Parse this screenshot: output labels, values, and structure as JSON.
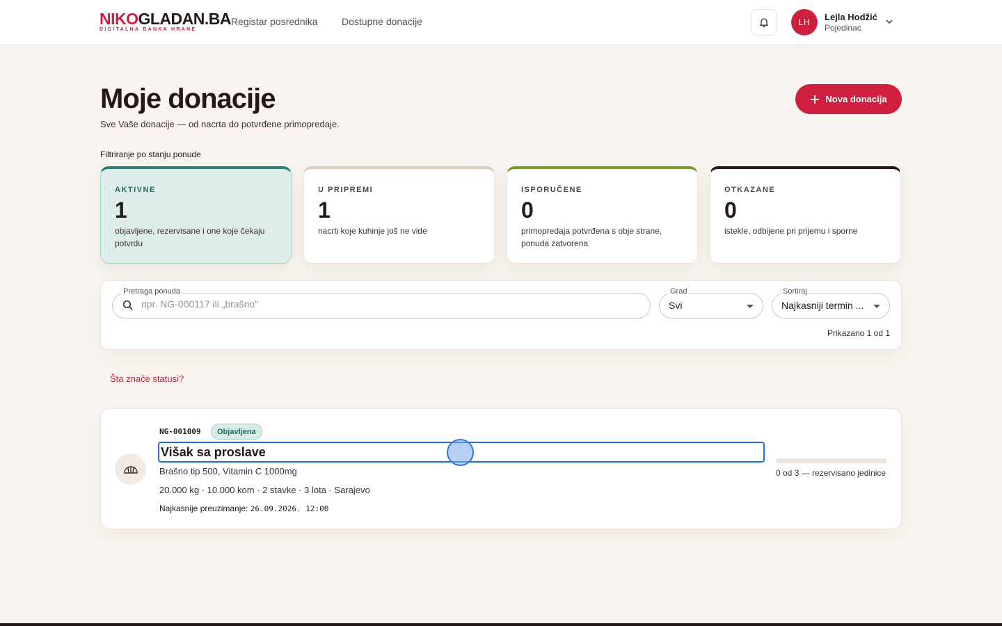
{
  "brand": {
    "logo_part1": "NIKO",
    "logo_part2": "GLADAN.BA",
    "tagline": "DIGITALNA BANKA HRANE"
  },
  "nav": {
    "link1": "Registar posrednika",
    "link2": "Dostupne donacije"
  },
  "user": {
    "initials": "LH",
    "name": "Lejla Hodžić",
    "role": "Pojedinac"
  },
  "page": {
    "title": "Moje donacije",
    "subtitle": "Sve Vaše donacije — od nacrta do potvrđene primopredaje.",
    "new_button": "Nova donacija"
  },
  "filters": {
    "heading": "Filtriranje po stanju ponude",
    "cards": [
      {
        "label": "AKTIVNE",
        "count": "1",
        "description": "objavljene, rezervisane i one koje čekaju potvrdu",
        "accent": "#2c7e74"
      },
      {
        "label": "U PRIPREMI",
        "count": "1",
        "description": "nacrti koje kuhinje još ne vide",
        "accent": "#d9cdbf"
      },
      {
        "label": "ISPORUČENE",
        "count": "0",
        "description": "primopredaja potvrđena s obje strane, ponuda zatvorena",
        "accent": "#7a9a2a"
      },
      {
        "label": "OTKAZANE",
        "count": "0",
        "description": "istekle, odbijene pri prijemu i sporne",
        "accent": "#231a17"
      }
    ]
  },
  "search": {
    "label": "Pretraga ponuda",
    "placeholder": "npr. NG-000117 ili „brašno\"",
    "city_label": "Grad",
    "city_value": "Svi",
    "sort_label": "Sortiraj",
    "sort_value": "Najkasniji termin ...",
    "result_count": "Prikazano 1 od 1"
  },
  "status_help": "Šta znače statusi?",
  "donation": {
    "code": "NG-001009",
    "status": "Objavljena",
    "title": "Višak sa proslave",
    "items": "Brašno tip 500, Vitamin C 1000mg",
    "meta": "20.000 kg · 10.000 kom · 2 stavke · 3 lota · Sarajevo",
    "pickup_label": "Najkasnije preuzimanje:",
    "pickup_value": "26.09.2026. 12:00",
    "reserved_fraction": 0,
    "progress_text": "0 od 3 — rezervisano jedinice"
  },
  "colors": {
    "brand_red": "#cf1f3f",
    "teal": "#2c7e74",
    "background": "#f9f4ef"
  }
}
